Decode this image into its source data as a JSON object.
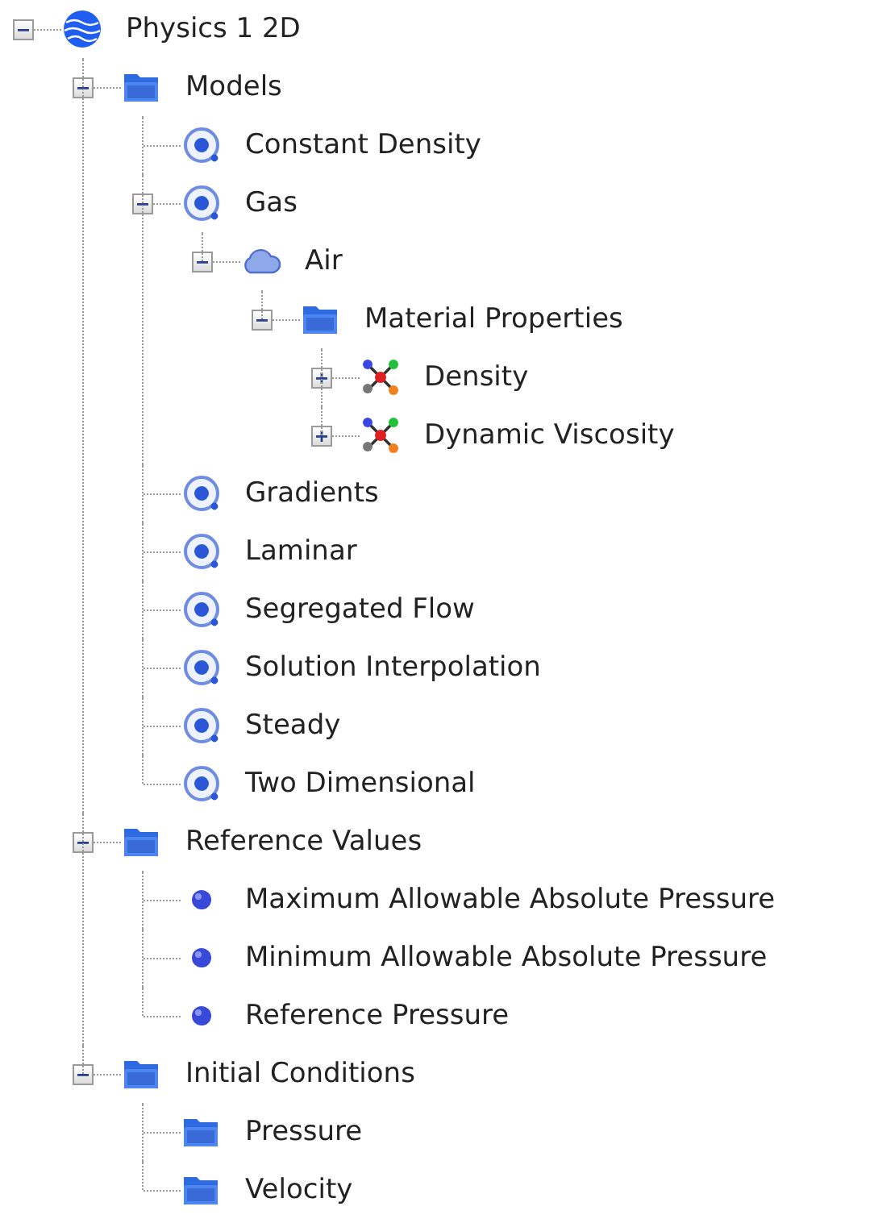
{
  "tree": [
    {
      "label": "Physics 1 2D",
      "kind": "physics",
      "expanded": true,
      "children": [
        {
          "label": "Models",
          "kind": "folder",
          "expanded": true,
          "children": [
            {
              "label": "Constant Density",
              "kind": "model"
            },
            {
              "label": "Gas",
              "kind": "model",
              "expanded": true,
              "children": [
                {
                  "label": "Air",
                  "kind": "material",
                  "expanded": true,
                  "children": [
                    {
                      "label": "Material Properties",
                      "kind": "folder",
                      "expanded": true,
                      "children": [
                        {
                          "label": "Density",
                          "kind": "function",
                          "expanded": false
                        },
                        {
                          "label": "Dynamic Viscosity",
                          "kind": "function",
                          "expanded": false
                        }
                      ]
                    }
                  ]
                }
              ]
            },
            {
              "label": "Gradients",
              "kind": "model"
            },
            {
              "label": "Laminar",
              "kind": "model"
            },
            {
              "label": "Segregated Flow",
              "kind": "model"
            },
            {
              "label": "Solution Interpolation",
              "kind": "model"
            },
            {
              "label": "Steady",
              "kind": "model"
            },
            {
              "label": "Two Dimensional",
              "kind": "model"
            }
          ]
        },
        {
          "label": "Reference Values",
          "kind": "folder",
          "expanded": true,
          "children": [
            {
              "label": "Maximum Allowable Absolute Pressure",
              "kind": "value"
            },
            {
              "label": "Minimum Allowable Absolute Pressure",
              "kind": "value"
            },
            {
              "label": "Reference Pressure",
              "kind": "value"
            }
          ]
        },
        {
          "label": "Initial Conditions",
          "kind": "folder",
          "expanded": true,
          "children": [
            {
              "label": "Pressure",
              "kind": "folder"
            },
            {
              "label": "Velocity",
              "kind": "folder"
            }
          ]
        }
      ]
    }
  ]
}
